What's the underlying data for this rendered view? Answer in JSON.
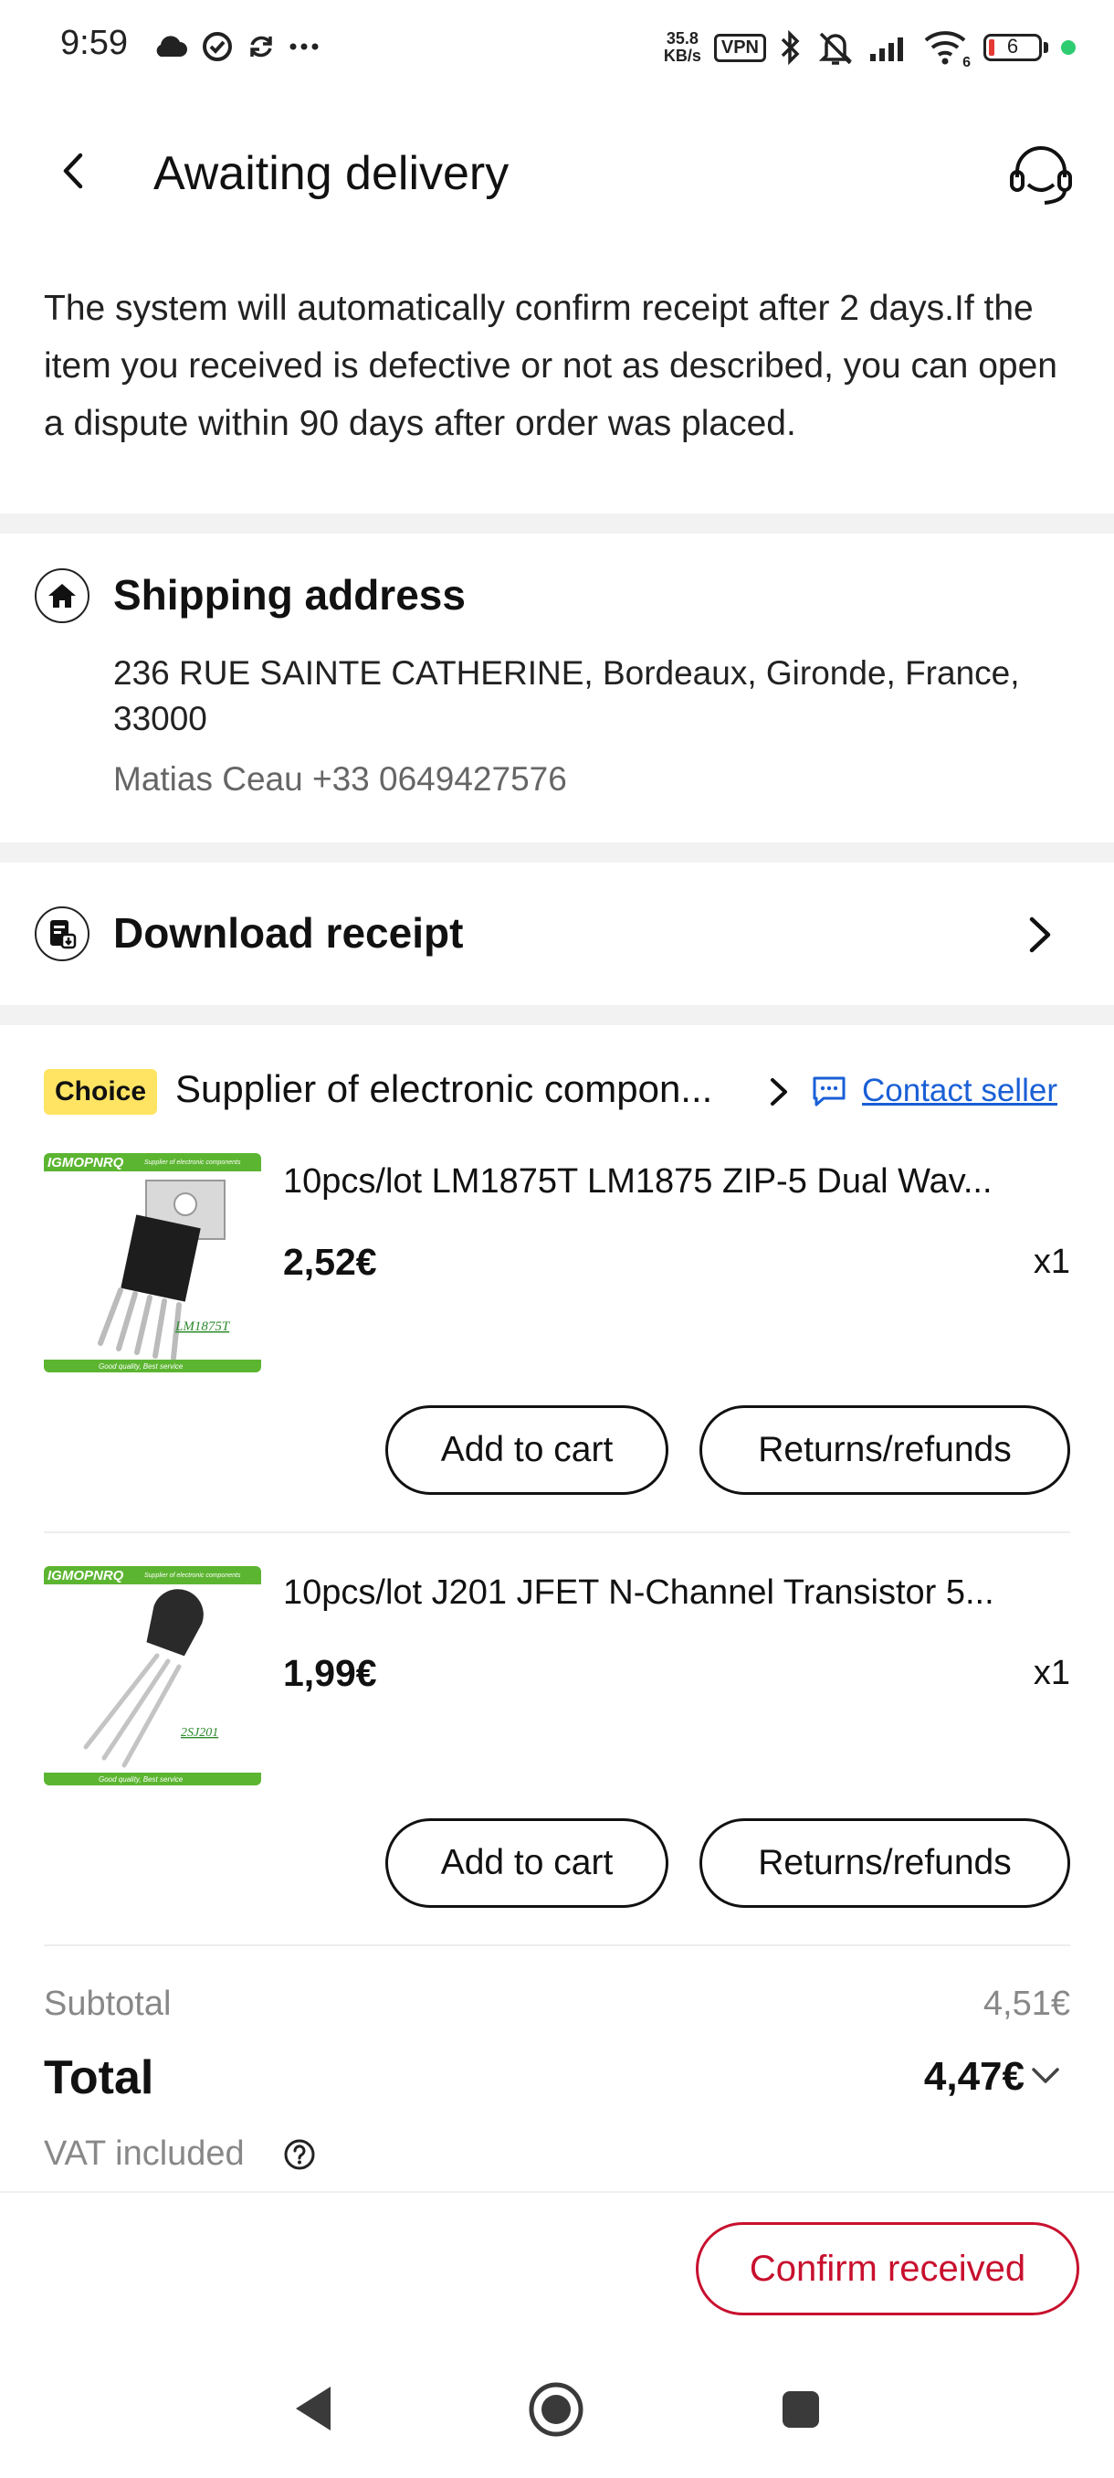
{
  "status_bar": {
    "time": "9:59",
    "net_speed_value": "35.8",
    "net_speed_unit": "KB/s",
    "vpn": "VPN",
    "battery_level": "6",
    "wifi_label": "6"
  },
  "header": {
    "title": "Awaiting delivery",
    "back_icon": "chevron-left-icon",
    "support_icon": "headset-icon"
  },
  "notice": "The system will automatically confirm receipt after 2 days.If the item you received is defective or not as described, you can open a dispute within 90 days after order was placed.",
  "shipping": {
    "title": "Shipping address",
    "address": "236 RUE SAINTE CATHERINE, Bordeaux, Gironde, France, 33000",
    "contact": "Matias Ceau +33 0649427576"
  },
  "receipt": {
    "title": "Download receipt"
  },
  "store": {
    "badge": "Choice",
    "name": "Supplier of electronic compon...",
    "contact_label": "Contact seller"
  },
  "products": [
    {
      "title": "10pcs/lot LM1875T LM1875 ZIP-5 Dual Wav...",
      "price": "2,52€",
      "qty": "x1",
      "image_brand": "IGMOPNRQ",
      "image_tagline": "Supplier of electronic components",
      "image_part": "LM1875T",
      "image_footer": "Good quality, Best service",
      "add_to_cart": "Add to cart",
      "returns": "Returns/refunds"
    },
    {
      "title": "10pcs/lot J201 JFET N-Channel Transistor 5...",
      "price": "1,99€",
      "qty": "x1",
      "image_brand": "IGMOPNRQ",
      "image_tagline": "Supplier of electronic components",
      "image_part": "2SJ201",
      "image_footer": "Good quality, Best service",
      "add_to_cart": "Add to cart",
      "returns": "Returns/refunds"
    }
  ],
  "summary": {
    "subtotal_label": "Subtotal",
    "subtotal_value": "4,51€",
    "total_label": "Total",
    "total_value": "4,47€",
    "vat_label": "VAT included"
  },
  "actions": {
    "confirm_received": "Confirm received"
  },
  "colors": {
    "accent_red": "#c8102e",
    "link_blue": "#1a5fd6",
    "choice_yellow": "#ffe463",
    "band_gray": "#f2f2f2"
  }
}
